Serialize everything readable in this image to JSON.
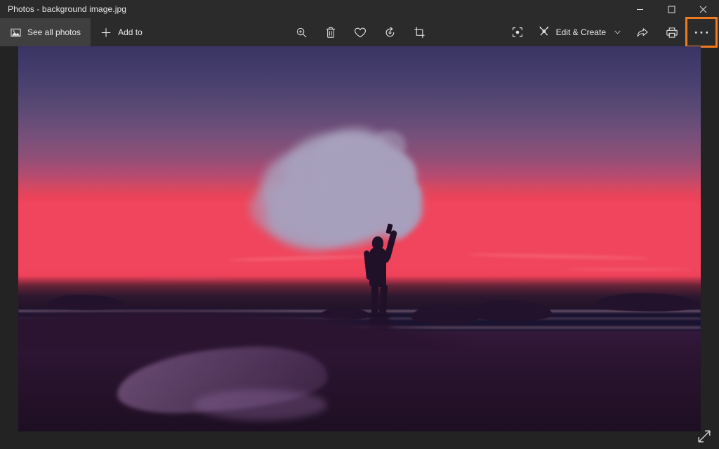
{
  "window": {
    "title": "Photos - background image.jpg",
    "controls": {
      "minimize": "Minimize",
      "maximize": "Maximize",
      "close": "Close"
    }
  },
  "toolbar": {
    "see_all_photos": "See all photos",
    "add_to": "Add to",
    "edit_and_create": "Edit & Create",
    "chevron": "⌄",
    "icons": {
      "see_all_photos": "photo-icon",
      "add_to": "plus-icon",
      "zoom": "zoom-in-icon",
      "delete": "trash-icon",
      "favorite": "heart-icon",
      "rotate": "rotate-icon",
      "crop": "crop-icon",
      "enhance": "enhance-icon",
      "edit_create": "pencils-icon",
      "share": "share-icon",
      "print": "print-icon",
      "see_more": "ellipsis-icon"
    },
    "tooltips": {
      "zoom": "Zoom",
      "delete": "Delete",
      "favorite": "Add to Favorites",
      "rotate": "Rotate",
      "crop": "Crop & rotate",
      "enhance": "Enhance your photo",
      "share": "Share",
      "print": "Print",
      "see_more": "See more"
    },
    "see_more_label": "···",
    "highlight_color": "#f07b1e"
  },
  "photo": {
    "alt": "Silhouette of a person holding a smoke flare on a beach at sunset",
    "resize_icon": "resize-diagonal-icon"
  },
  "colors": {
    "titlebar_bg": "#2b2b2b",
    "toolbar_bg": "#2b2b2b",
    "app_bg": "#232323",
    "text": "#e8e8e8",
    "accent": "#f07b1e",
    "sky_top": "#3a3463",
    "sky_mid": "#74507a",
    "sky_horizon": "#ee3f58",
    "smoke": "#a7a0bd",
    "silhouette": "#201028"
  }
}
